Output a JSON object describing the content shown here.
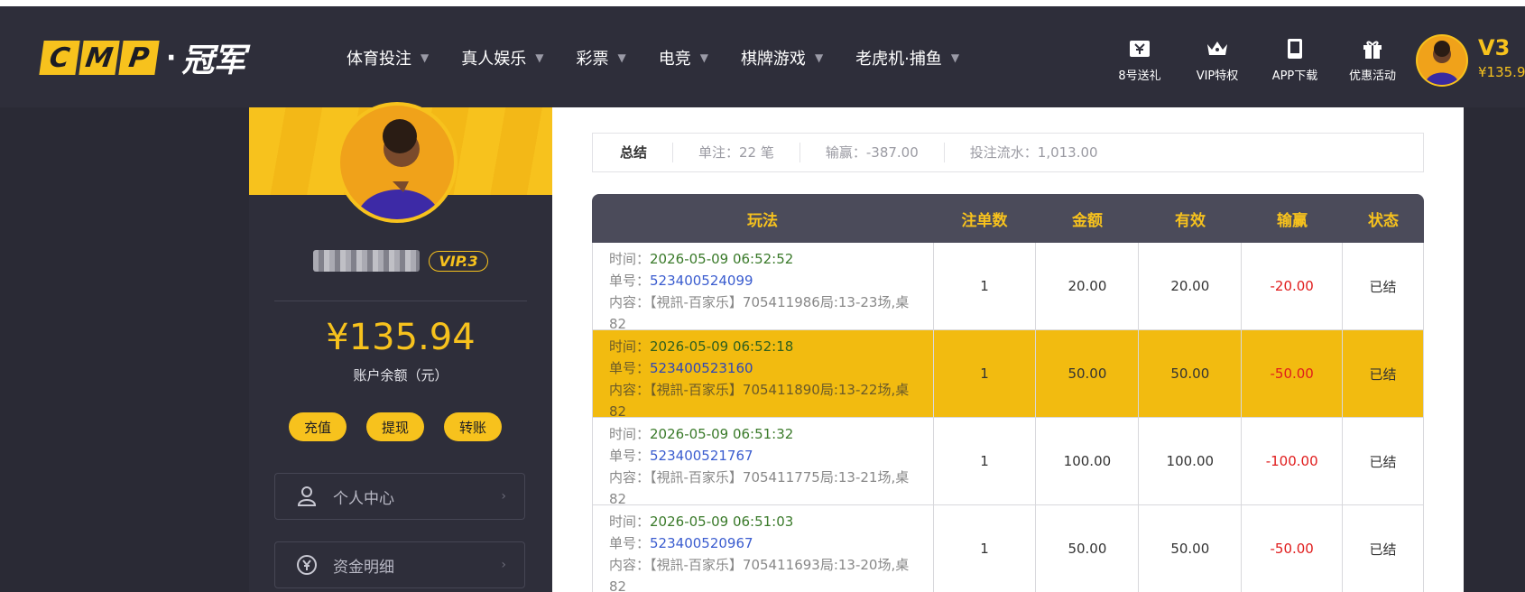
{
  "brand": {
    "logo_letters": [
      "C",
      "M",
      "P"
    ],
    "logo_cn": "冠军"
  },
  "nav": [
    {
      "label": "体育投注"
    },
    {
      "label": "真人娱乐"
    },
    {
      "label": "彩票"
    },
    {
      "label": "电竞"
    },
    {
      "label": "棋牌游戏"
    },
    {
      "label": "老虎机·捕鱼"
    }
  ],
  "tools": [
    {
      "label": "8号送礼",
      "icon": "gift-ticket-icon"
    },
    {
      "label": "VIP特权",
      "icon": "crown-icon"
    },
    {
      "label": "APP下载",
      "icon": "phone-icon"
    },
    {
      "label": "优惠活动",
      "icon": "gift-box-icon"
    }
  ],
  "user": {
    "vip_top": "V3",
    "balance_top": "¥135.9",
    "vip_badge": "VIP.3",
    "balance": "¥135.94",
    "balance_label": "账户余额（元）"
  },
  "actions": {
    "recharge": "充值",
    "withdraw": "提现",
    "transfer": "转账"
  },
  "menu": [
    {
      "label": "个人中心",
      "icon": "user-icon"
    },
    {
      "label": "资金明细",
      "icon": "yen-cycle-icon"
    }
  ],
  "summary": {
    "title": "总结",
    "orders": "单注：22 笔",
    "winloss": "输赢：-387.00",
    "turnover": "投注流水：1,013.00"
  },
  "table": {
    "headers": [
      "玩法",
      "注单数",
      "金额",
      "有效",
      "输赢",
      "状态"
    ],
    "label_time": "时间：",
    "label_no": "单号：",
    "label_content": "内容：",
    "rows": [
      {
        "time": "2026-05-09 06:52:52",
        "no": "523400524099",
        "content": "【視訊-百家乐】705411986局:13-23场,桌82",
        "count": "1",
        "amount": "20.00",
        "valid": "20.00",
        "winloss": "-20.00",
        "status": "已结"
      },
      {
        "time": "2026-05-09 06:52:18",
        "no": "523400523160",
        "content": "【視訊-百家乐】705411890局:13-22场,桌82",
        "count": "1",
        "amount": "50.00",
        "valid": "50.00",
        "winloss": "-50.00",
        "status": "已结"
      },
      {
        "time": "2026-05-09 06:51:32",
        "no": "523400521767",
        "content": "【視訊-百家乐】705411775局:13-21场,桌82",
        "count": "1",
        "amount": "100.00",
        "valid": "100.00",
        "winloss": "-100.00",
        "status": "已结"
      },
      {
        "time": "2026-05-09 06:51:03",
        "no": "523400520967",
        "content": "【視訊-百家乐】705411693局:13-20场,桌82",
        "count": "1",
        "amount": "50.00",
        "valid": "50.00",
        "winloss": "-50.00",
        "status": "已结"
      }
    ]
  },
  "colors": {
    "accent": "#f7c21d",
    "dark": "#2e2e3a",
    "negative": "#e01c1c",
    "highlight_row": "#f2bb10"
  }
}
